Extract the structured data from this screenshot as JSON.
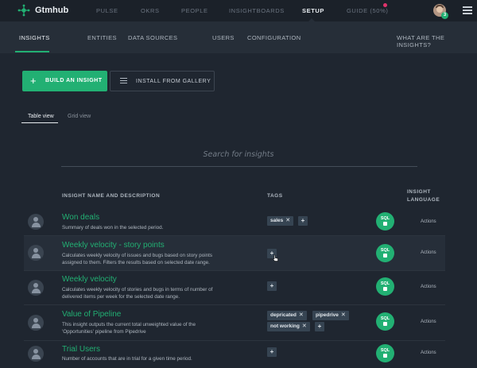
{
  "header": {
    "brand": "Gtmhub",
    "nav": [
      "PULSE",
      "OKRS",
      "PEOPLE",
      "INSIGHTBOARDS",
      "SETUP",
      "GUIDE (50%)"
    ],
    "active_nav": "SETUP",
    "avatar_badge": "3"
  },
  "subnav": {
    "items": [
      "INSIGHTS",
      "ENTITIES",
      "DATA SOURCES",
      "USERS",
      "CONFIGURATION"
    ],
    "active": "INSIGHTS",
    "help_link": "WHAT ARE THE INSIGHTS?"
  },
  "toolbar": {
    "build_label": "BUILD AN INSIGHT",
    "install_label": "INSTALL FROM GALLERY"
  },
  "views": {
    "table": "Table view",
    "grid": "Grid view",
    "active": "Table view"
  },
  "search": {
    "placeholder": "Search for insights"
  },
  "table": {
    "headers": {
      "name": "INSIGHT NAME AND DESCRIPTION",
      "tags": "TAGS",
      "language_line1": "INSIGHT",
      "language_line2": "LANGUAGE"
    },
    "rows": [
      {
        "title": "Won deals",
        "desc": "Summary of deals won in the selected period.",
        "tags": [
          "sales"
        ],
        "language": "SQL",
        "actions": "Actions"
      },
      {
        "title": "Weekly velocity - story points",
        "desc": "Calculates weekly velocity of issues and bugs based on story points assigned to them. Filters the results based on selected date range.",
        "tags": [],
        "language": "SQL",
        "actions": "Actions"
      },
      {
        "title": "Weekly velocity",
        "desc": "Calculates weekly velocity of stories and bugs in terms of number of delivered items per week for the selected date range.",
        "tags": [],
        "language": "SQL",
        "actions": "Actions"
      },
      {
        "title": "Value of Pipeline",
        "desc": "This insight outputs the current total unweighted value of the 'Opportunities' pipeline from Pipedrive",
        "tags": [
          "depricated",
          "pipedrive",
          "not working"
        ],
        "language": "SQL",
        "actions": "Actions"
      },
      {
        "title": "Trial Users",
        "desc": "Number of accounts that are in trial for a given time period.",
        "tags": [],
        "language": "SQL",
        "actions": "Actions"
      }
    ]
  },
  "colors": {
    "accent": "#22b073",
    "background": "#1f2630",
    "topbar": "#1b2129",
    "subnav": "#262e38",
    "tag": "#364452",
    "notification": "#e0336b"
  },
  "icons": {
    "logo": "gtmhub-logo-icon",
    "menu": "hamburger-menu-icon",
    "build": "plus-icon",
    "install": "list-icon",
    "user": "user-avatar-icon",
    "language": "sql-database-icon"
  }
}
